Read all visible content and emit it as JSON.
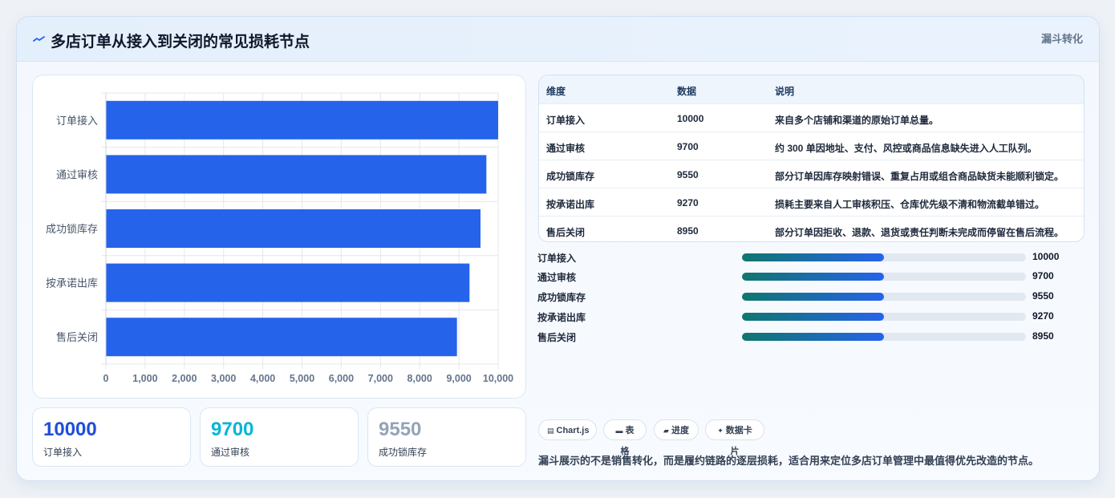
{
  "header": {
    "title": "多店订单从接入到关闭的常见损耗节点",
    "icon": "trend-line-icon",
    "tag": "漏斗转化"
  },
  "colors": {
    "bar": "#2563eb",
    "kpi1": "#1d4ed8",
    "kpi2": "#06b6d4",
    "kpi3": "#94a3b8"
  },
  "chart_data": {
    "type": "bar",
    "orientation": "horizontal",
    "categories": [
      "订单接入",
      "通过审核",
      "成功锁库存",
      "按承诺出库",
      "售后关闭"
    ],
    "values": [
      10000,
      9700,
      9550,
      9270,
      8950
    ],
    "xlim": [
      0,
      10000
    ],
    "xticks": [
      "0",
      "1,000",
      "2,000",
      "3,000",
      "4,000",
      "5,000",
      "6,000",
      "7,000",
      "8,000",
      "9,000",
      "10,000"
    ],
    "grid": true,
    "legend": "none"
  },
  "kpis": [
    {
      "value": "10000",
      "label": "订单接入"
    },
    {
      "value": "9700",
      "label": "通过审核"
    },
    {
      "value": "9550",
      "label": "成功锁库存"
    }
  ],
  "table": {
    "headers": [
      "维度",
      "数据",
      "说明"
    ],
    "rows": [
      {
        "dim": "订单接入",
        "value": "10000",
        "desc": "来自多个店铺和渠道的原始订单总量。"
      },
      {
        "dim": "通过审核",
        "value": "9700",
        "desc": "约 300 单因地址、支付、风控或商品信息缺失进入人工队列。"
      },
      {
        "dim": "成功锁库存",
        "value": "9550",
        "desc": "部分订单因库存映射错误、重复占用或组合商品缺货未能顺利锁定。"
      },
      {
        "dim": "按承诺出库",
        "value": "9270",
        "desc": "损耗主要来自人工审核积压、仓库优先级不清和物流截单错过。"
      },
      {
        "dim": "售后关闭",
        "value": "8950",
        "desc": "部分订单因拒收、退款、退货或责任判断未完成而停留在售后流程。"
      }
    ]
  },
  "progress": [
    {
      "label": "订单接入",
      "value": "10000",
      "fill": 0.5
    },
    {
      "label": "通过审核",
      "value": "9700",
      "fill": 0.5
    },
    {
      "label": "成功锁库存",
      "value": "9550",
      "fill": 0.5
    },
    {
      "label": "按承诺出库",
      "value": "9270",
      "fill": 0.5
    },
    {
      "label": "售后关闭",
      "value": "8950",
      "fill": 0.5
    }
  ],
  "chips": [
    {
      "icon": "chart-icon",
      "glyph": "▤",
      "label": "Chart.js"
    },
    {
      "icon": "table-icon",
      "glyph": "▬",
      "label": "表格"
    },
    {
      "icon": "progress-icon",
      "glyph": "▰",
      "label": "进度"
    },
    {
      "icon": "card-icon",
      "glyph": "✦",
      "label": "数据卡片"
    }
  ],
  "note": "漏斗展示的不是销售转化，而是履约链路的逐层损耗，适合用来定位多店订单管理中最值得优先改造的节点。"
}
